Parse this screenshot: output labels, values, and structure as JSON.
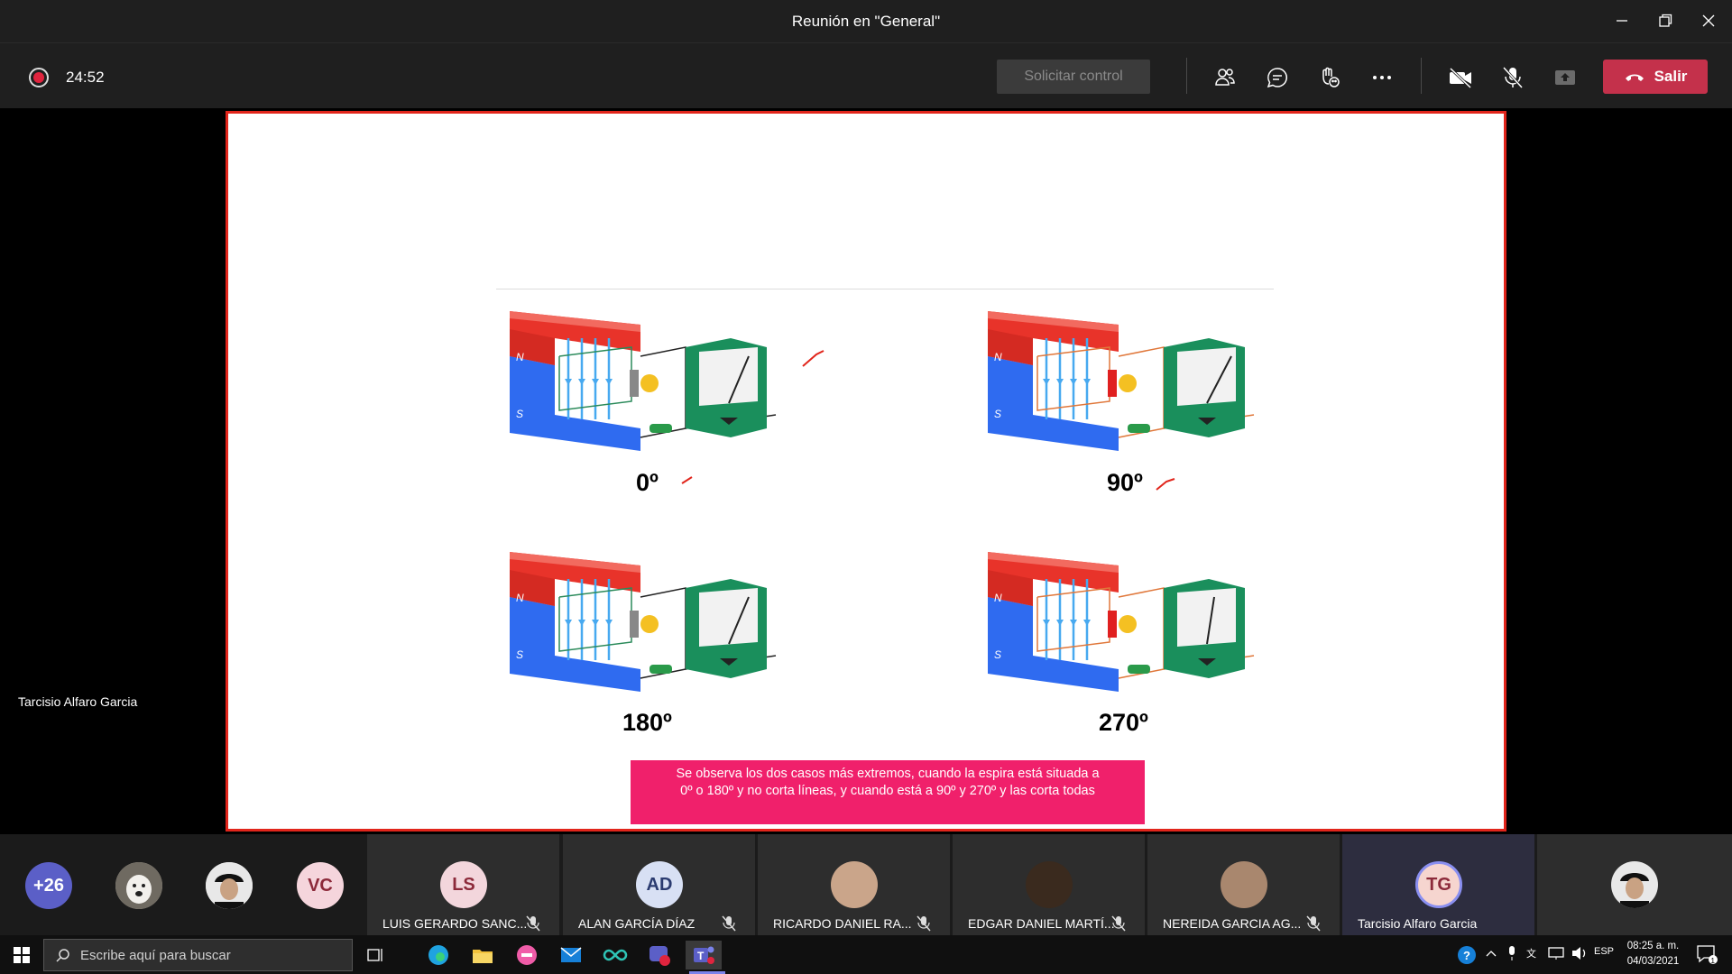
{
  "window": {
    "title": "Reunión en \"General\""
  },
  "toolbar": {
    "timer": "24:52",
    "request_control": "Solicitar control",
    "leave": "Salir"
  },
  "presenter_name": "Tarcisio Alfaro Garcia",
  "slide": {
    "angles": [
      "0º",
      "90º",
      "180º",
      "270º"
    ],
    "note": "Se observa los dos casos más extremos, cuando la espira está situada a 0º o 180º y no corta líneas, y cuando está a 90º y 270º y las corta todas",
    "pole_north": "N",
    "pole_south": "S"
  },
  "participants": {
    "overflow": "+26",
    "vc_initials": "VC",
    "tiles": [
      {
        "initials": "LS",
        "name": "LUIS GERARDO SANC...",
        "color": "#f3d6dc"
      },
      {
        "initials": "AD",
        "name": "ALAN GARCÍA DÍAZ",
        "color": "#d8e0f4"
      },
      {
        "initials": "",
        "name": "RICARDO DANIEL RA...",
        "color": "#caa58a"
      },
      {
        "initials": "",
        "name": "EDGAR DANIEL MARTÍ...",
        "color": "#3a2a1e"
      },
      {
        "initials": "",
        "name": "NEREIDA GARCIA AG...",
        "color": "#a9876e"
      },
      {
        "initials": "TG",
        "name": "Tarcisio Alfaro Garcia",
        "color": "#f6d5cf"
      }
    ]
  },
  "taskbar": {
    "search_placeholder": "Escribe aquí para buscar",
    "lang": "ESP",
    "time": "08:25 a. m.",
    "date": "04/03/2021"
  }
}
